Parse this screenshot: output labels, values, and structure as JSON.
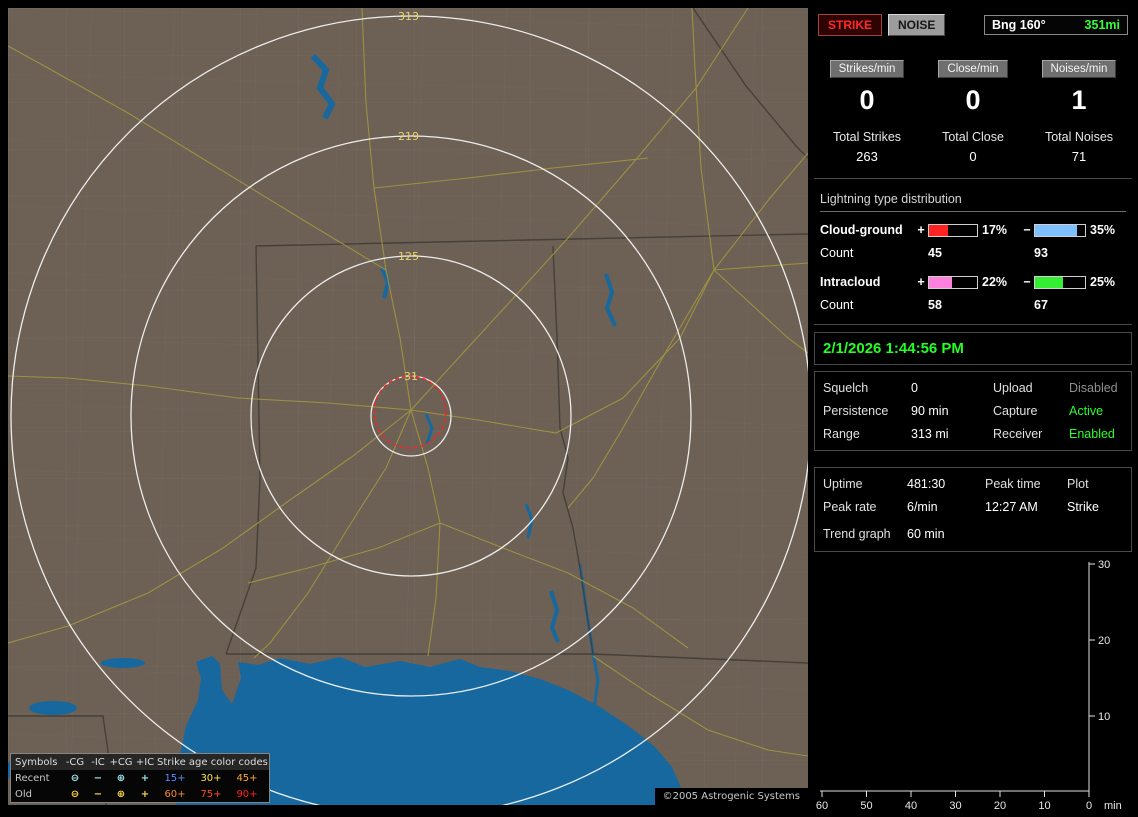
{
  "map": {
    "ring_labels": [
      "313",
      "219",
      "125",
      "31"
    ],
    "legend": {
      "col_symbols": "Symbols",
      "col_neg_cg": "-CG",
      "col_neg_ic": "-IC",
      "col_pos_cg": "+CG",
      "col_pos_ic": "+IC",
      "age_title": "Strike age color codes",
      "recent_label": "Recent",
      "old_label": "Old",
      "sym_neg_cg": "⊖",
      "sym_neg_ic": "−",
      "sym_pos_cg": "⊕",
      "sym_pos_ic": "+",
      "recent_ages": [
        "15+",
        "30+",
        "45+"
      ],
      "old_ages": [
        "60+",
        "75+",
        "90+"
      ]
    },
    "copyright": "©2005 Astrogenic Systems"
  },
  "panel": {
    "strike_button": "STRIKE",
    "noise_button": "NOISE",
    "bearing_label": "Bng 160°",
    "bearing_value": "351mi",
    "rates": [
      {
        "label": "Strikes/min",
        "value": "0",
        "total_label": "Total Strikes",
        "total_value": "263"
      },
      {
        "label": "Close/min",
        "value": "0",
        "total_label": "Total Close",
        "total_value": "0"
      },
      {
        "label": "Noises/min",
        "value": "1",
        "total_label": "Total Noises",
        "total_value": "71"
      }
    ],
    "distribution": {
      "title": "Lightning type distribution",
      "plus_sign": "+",
      "minus_sign": "−",
      "rows": [
        {
          "label": "Cloud-ground",
          "plus_pct": "17%",
          "plus_fill_width": "40%",
          "minus_pct": "35%",
          "minus_fill_width": "84%",
          "count_label": "Count",
          "plus_count": "45",
          "minus_count": "93"
        },
        {
          "label": "Intracloud",
          "plus_pct": "22%",
          "plus_fill_width": "48%",
          "minus_pct": "25%",
          "minus_fill_width": "55%",
          "count_label": "Count",
          "plus_count": "58",
          "minus_count": "67"
        }
      ]
    },
    "datetime": "2/1/2026 1:44:56 PM",
    "settings": [
      {
        "label_left": "Squelch",
        "value_left": "0",
        "label_right": "Upload",
        "value_right": "Disabled"
      },
      {
        "label_left": "Persistence",
        "value_left": "90 min",
        "label_right": "Capture",
        "value_right": "Active"
      },
      {
        "label_left": "Range",
        "value_left": "313 mi",
        "label_right": "Receiver",
        "value_right": "Enabled"
      }
    ],
    "status": {
      "uptime_label": "Uptime",
      "uptime_value": "481:30",
      "peak_time_label": "Peak time",
      "plot_label": "Plot",
      "peak_rate_label": "Peak rate",
      "peak_rate_value": "6/min",
      "peak_time_value": "12:27 AM",
      "plot_value": "Strike",
      "trend_label": "Trend graph",
      "trend_value": "60 min"
    },
    "graph": {
      "y_ticks": [
        "30",
        "20",
        "10"
      ],
      "x_ticks": [
        "60",
        "50",
        "40",
        "30",
        "20",
        "10",
        "0"
      ],
      "x_unit": "min"
    },
    "colors": {
      "strike_text": "#ff2a2a",
      "bearing_distance": "#33ff33",
      "datetime": "#22ff22",
      "status_active": "#2aff2a",
      "cg_plus_bar": "#ff2222",
      "cg_minus_bar": "#7fbfff",
      "ic_plus_bar": "#ff80dd",
      "ic_minus_bar": "#33ee33"
    }
  }
}
